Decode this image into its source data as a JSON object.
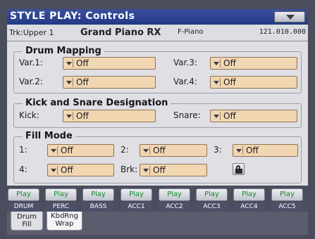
{
  "header": {
    "title": "STYLE PLAY: Controls",
    "menu_icon": "chevron-down-icon"
  },
  "track": {
    "label": "Trk:Upper 1",
    "sound_name": "Grand Piano RX",
    "family": "F-Piano",
    "bank": "121.010.000"
  },
  "drum_mapping": {
    "title": "Drum Mapping",
    "items": [
      {
        "label": "Var.1:",
        "value": "Off"
      },
      {
        "label": "Var.2:",
        "value": "Off"
      },
      {
        "label": "Var.3:",
        "value": "Off"
      },
      {
        "label": "Var.4:",
        "value": "Off"
      }
    ]
  },
  "kick_snare": {
    "title": "Kick and Snare Designation",
    "kick_label": "Kick:",
    "kick_value": "Off",
    "snare_label": "Snare:",
    "snare_value": "Off"
  },
  "fill_mode": {
    "title": "Fill Mode",
    "items": [
      {
        "label": "1:",
        "value": "Off"
      },
      {
        "label": "2:",
        "value": "Off"
      },
      {
        "label": "3:",
        "value": "Off"
      },
      {
        "label": "4:",
        "value": "Off"
      },
      {
        "label": "Brk:",
        "value": "Off"
      }
    ],
    "lock_icon": "lock-icon"
  },
  "play_buttons": {
    "label": "Play",
    "tracks": [
      "DRUM",
      "PERC",
      "BASS",
      "ACC1",
      "ACC2",
      "ACC3",
      "ACC4",
      "ACC5"
    ]
  },
  "tabs": [
    {
      "line1": "Drum",
      "line2": "Fill"
    },
    {
      "line1": "KbdRng",
      "line2": "Wrap"
    }
  ],
  "colors": {
    "title_bar": "#233a86",
    "combo_fill": "#f1d6b2",
    "play_text": "#0e8a2a"
  }
}
